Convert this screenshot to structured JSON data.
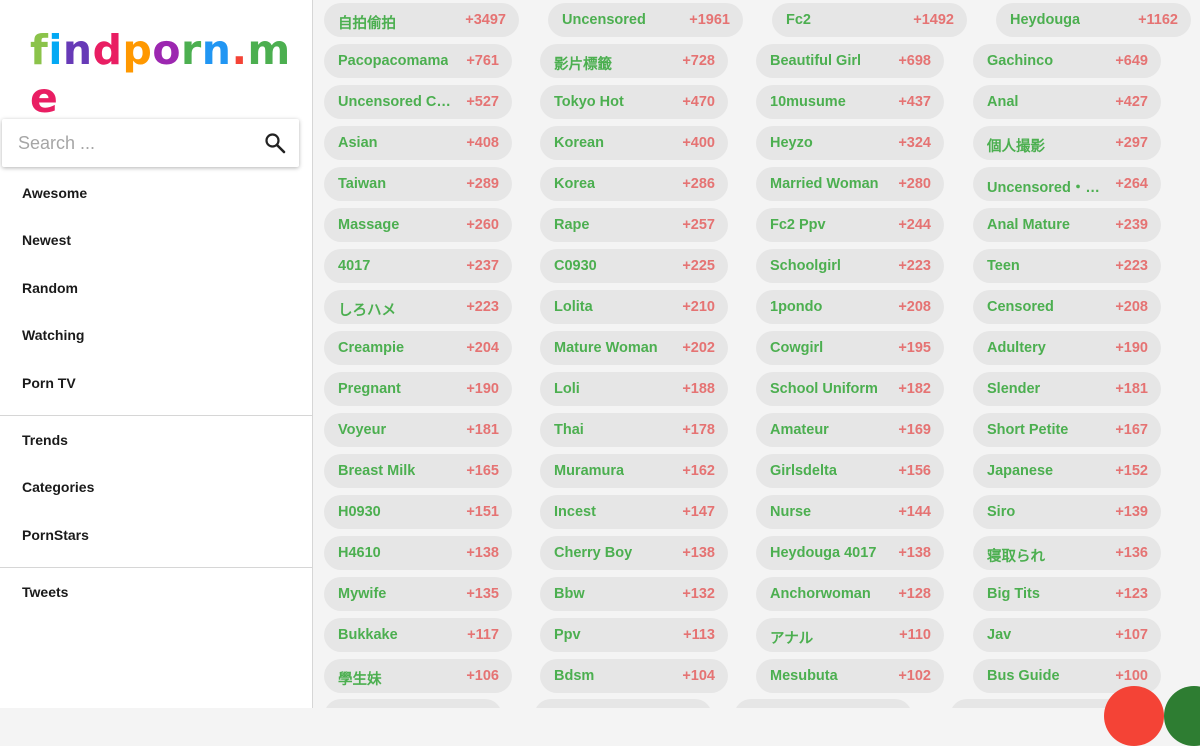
{
  "logo": {
    "letters": [
      {
        "ch": "f",
        "color": "#8bc34a"
      },
      {
        "ch": "i",
        "color": "#03a9f4"
      },
      {
        "ch": "n",
        "color": "#673ab7"
      },
      {
        "ch": "d",
        "color": "#e91e63"
      },
      {
        "ch": "p",
        "color": "#ff9800"
      },
      {
        "ch": "o",
        "color": "#9c27b0"
      },
      {
        "ch": "r",
        "color": "#4caf50"
      },
      {
        "ch": "n",
        "color": "#2196f3"
      },
      {
        "ch": ".",
        "color": "#f44336"
      },
      {
        "ch": "m",
        "color": "#4caf50"
      },
      {
        "ch": "e",
        "color": "#e91e63"
      }
    ]
  },
  "search": {
    "placeholder": "Search ..."
  },
  "menu": {
    "awesome": "Awesome",
    "newest": "Newest",
    "random": "Random",
    "watching": "Watching",
    "porn_tv": "Porn TV",
    "trends": "Trends",
    "categories": "Categories",
    "pornstars": "PornStars",
    "tweets": "Tweets"
  },
  "top_tags": [
    {
      "name": "自拍偷拍",
      "count": "+3497"
    },
    {
      "name": "Uncensored",
      "count": "+1961"
    },
    {
      "name": "Fc2",
      "count": "+1492"
    },
    {
      "name": "Heydouga",
      "count": "+1162"
    }
  ],
  "tags": [
    {
      "name": "Pacopacomama",
      "count": "+761"
    },
    {
      "name": "影片標籤",
      "count": "+728"
    },
    {
      "name": "Beautiful Girl",
      "count": "+698"
    },
    {
      "name": "Gachinco",
      "count": "+649"
    },
    {
      "name": "Uncensored Creampie",
      "count": "+527"
    },
    {
      "name": "Tokyo Hot",
      "count": "+470"
    },
    {
      "name": "10musume",
      "count": "+437"
    },
    {
      "name": "Anal",
      "count": "+427"
    },
    {
      "name": "Asian",
      "count": "+408"
    },
    {
      "name": "Korean",
      "count": "+400"
    },
    {
      "name": "Heyzo",
      "count": "+324"
    },
    {
      "name": "個人撮影",
      "count": "+297"
    },
    {
      "name": "Taiwan",
      "count": "+289"
    },
    {
      "name": "Korea",
      "count": "+286"
    },
    {
      "name": "Married Woman",
      "count": "+280"
    },
    {
      "name": "Uncensored・無修正",
      "count": "+264"
    },
    {
      "name": "Massage",
      "count": "+260"
    },
    {
      "name": "Rape",
      "count": "+257"
    },
    {
      "name": "Fc2 Ppv",
      "count": "+244"
    },
    {
      "name": "Anal Mature",
      "count": "+239"
    },
    {
      "name": "4017",
      "count": "+237"
    },
    {
      "name": "C0930",
      "count": "+225"
    },
    {
      "name": "Schoolgirl",
      "count": "+223"
    },
    {
      "name": "Teen",
      "count": "+223"
    },
    {
      "name": "しろハメ",
      "count": "+223"
    },
    {
      "name": "Lolita",
      "count": "+210"
    },
    {
      "name": "1pondo",
      "count": "+208"
    },
    {
      "name": "Censored",
      "count": "+208"
    },
    {
      "name": "Creampie",
      "count": "+204"
    },
    {
      "name": "Mature Woman",
      "count": "+202"
    },
    {
      "name": "Cowgirl",
      "count": "+195"
    },
    {
      "name": "Adultery",
      "count": "+190"
    },
    {
      "name": "Pregnant",
      "count": "+190"
    },
    {
      "name": "Loli",
      "count": "+188"
    },
    {
      "name": "School Uniform",
      "count": "+182"
    },
    {
      "name": "Slender",
      "count": "+181"
    },
    {
      "name": "Voyeur",
      "count": "+181"
    },
    {
      "name": "Thai",
      "count": "+178"
    },
    {
      "name": "Amateur",
      "count": "+169"
    },
    {
      "name": "Short Petite",
      "count": "+167"
    },
    {
      "name": "Breast Milk",
      "count": "+165"
    },
    {
      "name": "Muramura",
      "count": "+162"
    },
    {
      "name": "Girlsdelta",
      "count": "+156"
    },
    {
      "name": "Japanese",
      "count": "+152"
    },
    {
      "name": "H0930",
      "count": "+151"
    },
    {
      "name": "Incest",
      "count": "+147"
    },
    {
      "name": "Nurse",
      "count": "+144"
    },
    {
      "name": "Siro",
      "count": "+139"
    },
    {
      "name": "H4610",
      "count": "+138"
    },
    {
      "name": "Cherry Boy",
      "count": "+138"
    },
    {
      "name": "Heydouga 4017",
      "count": "+138"
    },
    {
      "name": "寝取られ",
      "count": "+136"
    },
    {
      "name": "Mywife",
      "count": "+135"
    },
    {
      "name": "Bbw",
      "count": "+132"
    },
    {
      "name": "Anchorwoman",
      "count": "+128"
    },
    {
      "name": "Big Tits",
      "count": "+123"
    },
    {
      "name": "Bukkake",
      "count": "+117"
    },
    {
      "name": "Ppv",
      "count": "+113"
    },
    {
      "name": "アナル",
      "count": "+110"
    },
    {
      "name": "Jav",
      "count": "+107"
    },
    {
      "name": "學生妹",
      "count": "+106"
    },
    {
      "name": "Bdsm",
      "count": "+104"
    },
    {
      "name": "Mesubuta",
      "count": "+102"
    },
    {
      "name": "Bus Guide",
      "count": "+100"
    }
  ],
  "colors": {
    "tag_name": "#4caf50",
    "tag_count": "#e57373",
    "tag_bg": "#e6e6e6"
  }
}
